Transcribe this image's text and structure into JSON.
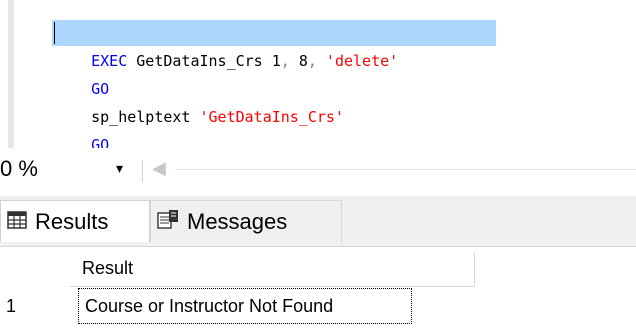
{
  "editor": {
    "lines": [
      {
        "kw": "EXEC",
        "ident": " GetDataIns_Crs ",
        "a": "1",
        "comma1": ",",
        "b": " 8",
        "comma2": ",",
        "str": " 'delete'"
      },
      {
        "kw": "GO"
      },
      {
        "ident": "sp_helptext ",
        "str": "'GetDataIns_Crs'"
      },
      {
        "kw": "GO"
      }
    ]
  },
  "zoom": {
    "value": "0 %",
    "arrow": "▾"
  },
  "tabs": [
    {
      "label": "Results",
      "icon": "grid-icon"
    },
    {
      "label": "Messages",
      "icon": "messages-icon"
    }
  ],
  "grid": {
    "columns": [
      "Result"
    ],
    "rows": [
      {
        "num": "1",
        "cells": [
          "Course or Instructor Not Found"
        ]
      }
    ]
  },
  "colors": {
    "keyword": "#0000ff",
    "string": "#ff0000",
    "selection": "#add6ff"
  }
}
